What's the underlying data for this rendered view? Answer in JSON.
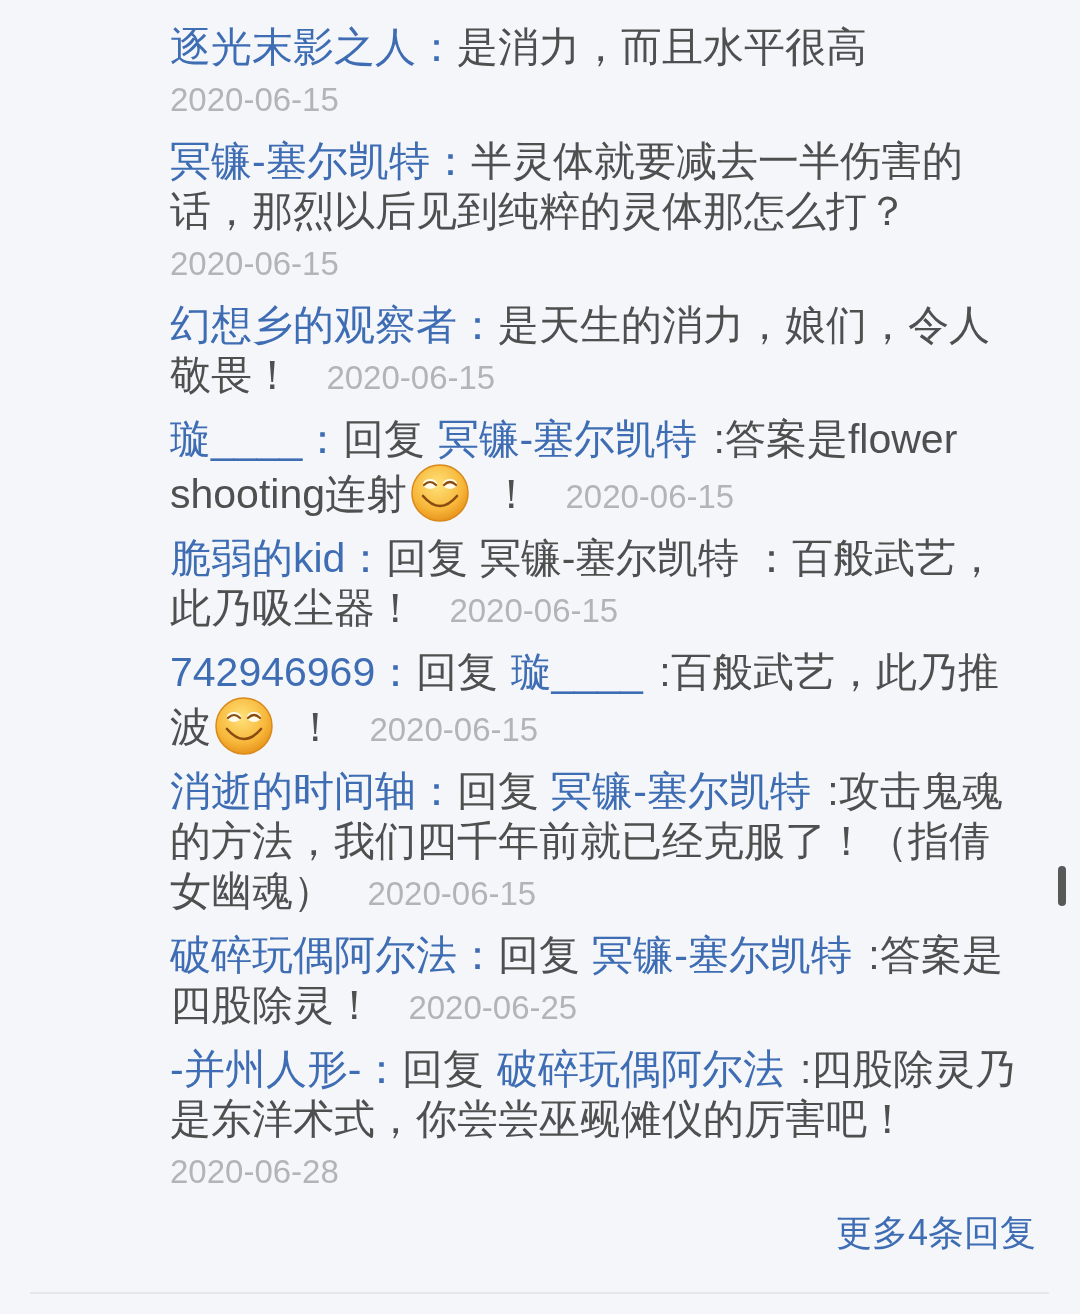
{
  "replies": [
    {
      "author": "逐光末影之人：",
      "parts": [
        {
          "kind": "text",
          "text": "是消力，而且水平很高"
        }
      ],
      "date": "2020-06-15"
    },
    {
      "author": "冥镰-塞尔凯特：",
      "parts": [
        {
          "kind": "text",
          "text": "半灵体就要减去一半伤害的话，那烈以后见到纯粹的灵体那怎么打？"
        }
      ],
      "date": "2020-06-15"
    },
    {
      "author": "幻想乡的观察者：",
      "parts": [
        {
          "kind": "text",
          "text": "是天生的消力，娘们，令人敬畏！"
        }
      ],
      "date": "2020-06-15"
    },
    {
      "author": "璇____：",
      "reply_label": "回复",
      "reply_to": "冥镰-塞尔凯特",
      "parts": [
        {
          "kind": "text",
          "text": ":答案是flower shooting连射"
        },
        {
          "kind": "emoji"
        },
        {
          "kind": "text",
          "text": "！"
        }
      ],
      "date": "2020-06-15"
    },
    {
      "author": "脆弱的kid：",
      "parts": [
        {
          "kind": "text",
          "text": "回复 冥镰-塞尔凯特 ：百般武艺，此乃吸尘器！"
        }
      ],
      "date": "2020-06-15"
    },
    {
      "author": "742946969：",
      "reply_label": "回复",
      "reply_to": "璇____",
      "parts": [
        {
          "kind": "text",
          "text": ":百般武艺，此乃推波"
        },
        {
          "kind": "emoji"
        },
        {
          "kind": "text",
          "text": "！"
        }
      ],
      "date": "2020-06-15"
    },
    {
      "author": "消逝的时间轴：",
      "reply_label": "回复",
      "reply_to": "冥镰-塞尔凯特",
      "parts": [
        {
          "kind": "text",
          "text": ":攻击鬼魂的方法，我们四千年前就已经克服了！（指倩女幽魂）"
        }
      ],
      "date": "2020-06-15"
    },
    {
      "author": "破碎玩偶阿尔法：",
      "reply_label": "回复",
      "reply_to": "冥镰-塞尔凯特",
      "parts": [
        {
          "kind": "text",
          "text": ":答案是四股除灵！"
        }
      ],
      "date": "2020-06-25"
    },
    {
      "author": "-并州人形-：",
      "reply_label": "回复",
      "reply_to": "破碎玩偶阿尔法",
      "parts": [
        {
          "kind": "text",
          "text": ":四股除灵乃是东洋术式，你尝尝巫觋傩仪的厉害吧！"
        }
      ],
      "date": "2020-06-28"
    }
  ],
  "more_link": "更多4条回复"
}
